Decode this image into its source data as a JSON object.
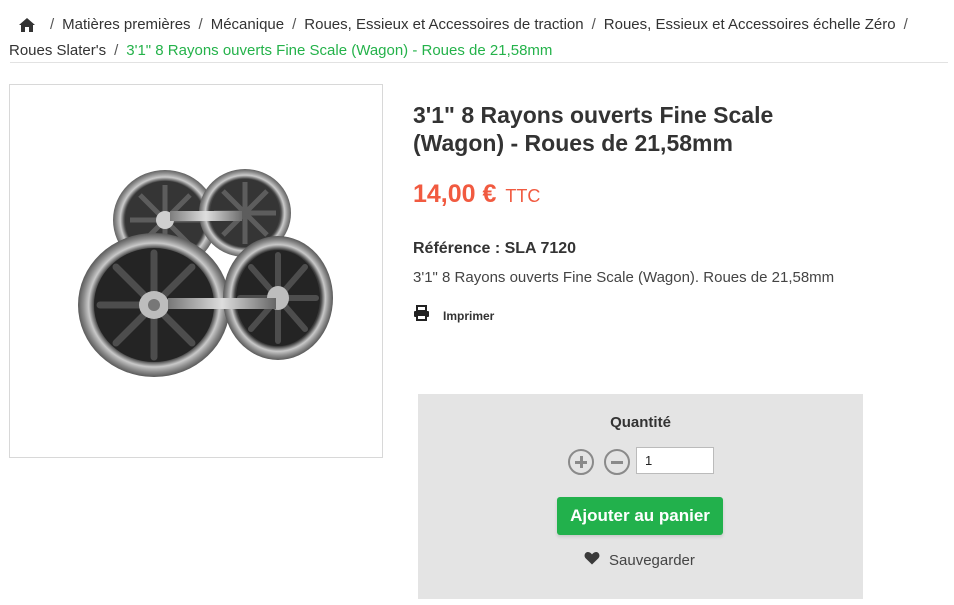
{
  "breadcrumb": {
    "home_icon": "home-icon",
    "items": [
      "Matières premières",
      "Mécanique",
      "Roues, Essieux et Accessoires de traction",
      "Roues, Essieux et Accessoires échelle Zéro",
      "Roues Slater's"
    ],
    "current": "3'1\" 8 Rayons ouverts Fine Scale (Wagon) - Roues de 21,58mm",
    "separator": "/"
  },
  "product": {
    "title": "3'1\" 8 Rayons ouverts Fine Scale (Wagon) - Roues de 21,58mm",
    "price": "14,00 €",
    "price_suffix": "TTC",
    "reference_label": "Référence :",
    "reference": "SLA 7120",
    "description": "3'1\" 8 Rayons ouverts Fine Scale (Wagon). Roues de 21,58mm",
    "print_label": "Imprimer",
    "print_icon": "printer-icon",
    "image_icon": "wheelset-image"
  },
  "cart": {
    "quantity_label": "Quantité",
    "quantity_value": "1",
    "add_label": "Ajouter au panier",
    "save_label": "Sauvegarder",
    "save_icon": "heart-icon",
    "plus_icon": "plus-circle-icon",
    "minus_icon": "minus-circle-icon"
  },
  "colors": {
    "accent_green": "#22b14c",
    "breadcrumb_current": "#24b24a",
    "price": "#f15a40",
    "cart_bg": "#e4e4e4"
  }
}
